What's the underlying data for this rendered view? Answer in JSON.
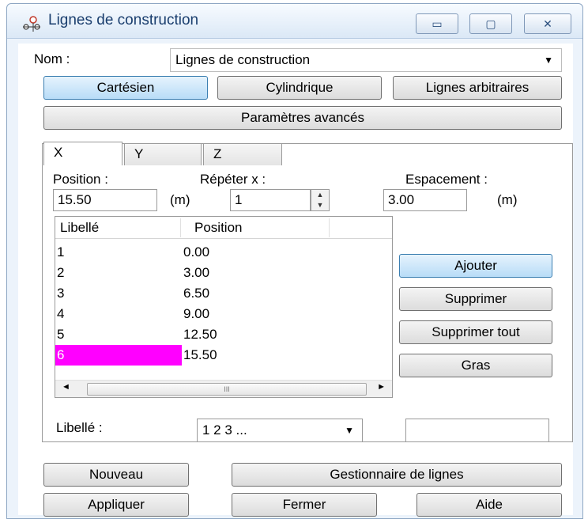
{
  "window": {
    "title": "Lignes de construction",
    "min_glyph": "▭",
    "max_glyph": "▢",
    "close_glyph": "✕"
  },
  "name_row": {
    "label": "Nom :",
    "value": "Lignes de construction"
  },
  "mode_buttons": {
    "cartesian": "Cartésien",
    "cylindrical": "Cylindrique",
    "arbitrary": "Lignes arbitraires",
    "advanced": "Paramètres avancés"
  },
  "tabs": [
    "X",
    "Y",
    "Z"
  ],
  "fields": {
    "position_label": "Position :",
    "position_value": "15.50",
    "position_unit": "(m)",
    "repeat_label": "Répéter x :",
    "repeat_value": "1",
    "spacing_label": "Espacement :",
    "spacing_value": "3.00",
    "spacing_unit": "(m)"
  },
  "table": {
    "headers": [
      "Libellé",
      "Position"
    ],
    "rows": [
      {
        "label": "1",
        "position": "0.00"
      },
      {
        "label": "2",
        "position": "3.00"
      },
      {
        "label": "3",
        "position": "6.50"
      },
      {
        "label": "4",
        "position": "9.00"
      },
      {
        "label": "5",
        "position": "12.50"
      },
      {
        "label": "6",
        "position": "15.50"
      }
    ],
    "selected_row": 5,
    "selected_color": "#ff00ff"
  },
  "side_buttons": {
    "add": "Ajouter",
    "delete": "Supprimer",
    "delete_all": "Supprimer tout",
    "bold": "Gras"
  },
  "label_row": {
    "label": "Libellé :",
    "value": "1 2 3 ..."
  },
  "bottom_buttons": {
    "new": "Nouveau",
    "manager": "Gestionnaire de lignes",
    "apply": "Appliquer",
    "close": "Fermer",
    "help": "Aide"
  }
}
